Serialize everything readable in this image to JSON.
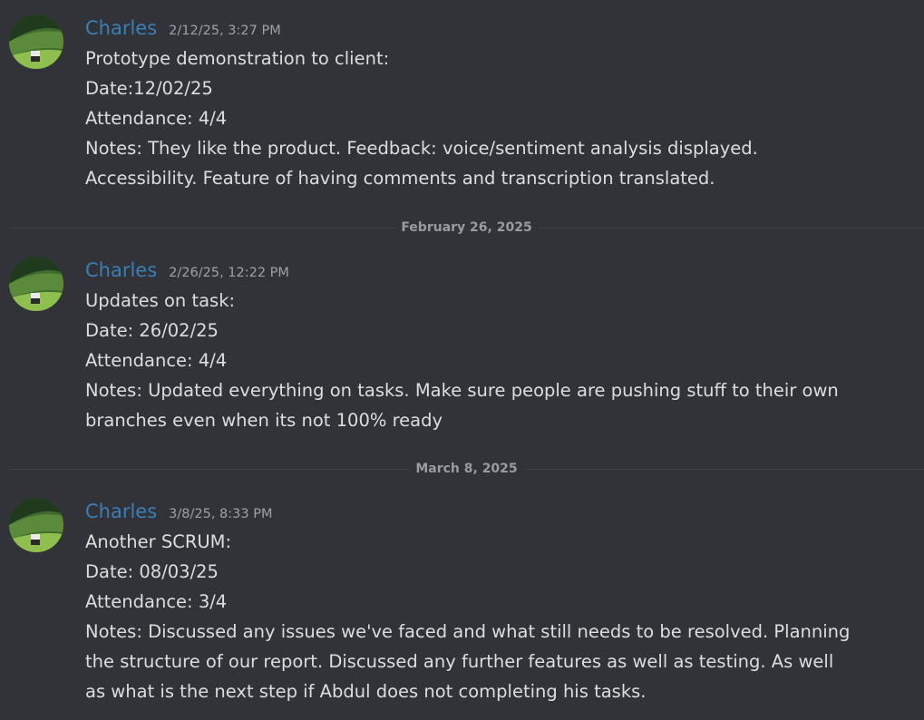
{
  "messages": [
    {
      "author": "Charles",
      "timestamp": "2/12/25, 3:27 PM",
      "lines": [
        "Prototype demonstration to client:",
        "Date:12/02/25",
        "Attendance: 4/4",
        "Notes: They like the product. Feedback: voice/sentiment analysis displayed.",
        "Accessibility. Feature of having comments and transcription translated."
      ]
    },
    {
      "author": "Charles",
      "timestamp": "2/26/25, 12:22 PM",
      "lines": [
        "Updates on task:",
        "Date: 26/02/25",
        "Attendance: 4/4",
        "Notes: Updated everything on tasks. Make sure people are pushing stuff to their own",
        "branches even when its not 100% ready"
      ]
    },
    {
      "author": "Charles",
      "timestamp": "3/8/25, 8:33 PM",
      "lines": [
        "Another SCRUM:",
        "Date: 08/03/25",
        "Attendance: 3/4",
        "Notes: Discussed any issues we've faced and what still needs to be resolved. Planning",
        "the structure of our report. Discussed any further features as well as testing. As well",
        "as what is the next step if Abdul does not completing his tasks."
      ]
    }
  ],
  "date_dividers": [
    "February 26, 2025",
    "March 8, 2025"
  ],
  "colors": {
    "background": "#313338",
    "username": "#3a7fb5",
    "message_text": "#dcdde1",
    "timestamp": "#9ea1a9",
    "divider_label": "#979ba2"
  },
  "icons": {
    "avatar": "landscape-avatar-icon"
  }
}
